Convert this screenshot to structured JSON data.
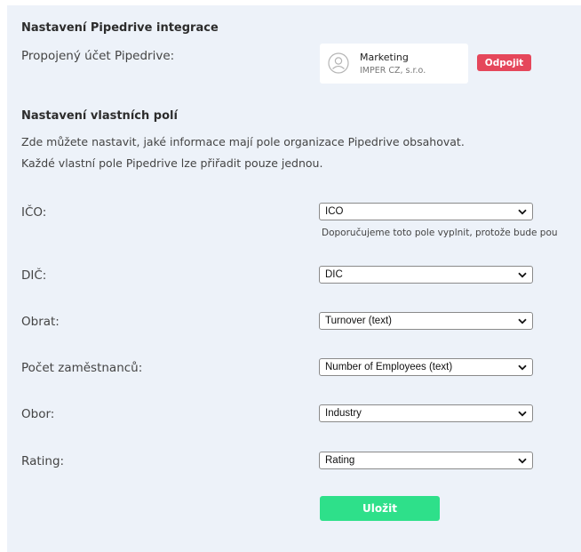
{
  "integration": {
    "heading": "Nastavení Pipedrive integrace",
    "linked_account_label": "Propojený účet Pipedrive:",
    "account": {
      "name": "Marketing",
      "company": "IMPER CZ, s.r.o.",
      "avatar_icon": "user-circle-icon"
    },
    "disconnect_label": "Odpojit"
  },
  "custom_fields": {
    "heading": "Nastavení vlastních polí",
    "description_line1": "Zde můžete nastavit, jaké informace mají pole organizace Pipedrive obsahovat.",
    "description_line2": "Každé vlastní pole Pipedrive lze přiřadit pouze jednou.",
    "rows": [
      {
        "label": "IČO:",
        "selected": "ICO"
      },
      {
        "label": "DIČ:",
        "selected": "DIC"
      },
      {
        "label": "Obrat:",
        "selected": "Turnover (text)"
      },
      {
        "label": "Počet zaměstnanců:",
        "selected": "Number of Employees (text)"
      },
      {
        "label": "Obor:",
        "selected": "Industry"
      },
      {
        "label": "Rating:",
        "selected": "Rating"
      }
    ],
    "ico_hint": "Doporučujeme toto pole vyplnit, protože bude pou"
  },
  "save_label": "Uložit",
  "colors": {
    "panel_bg": "#edf2f9",
    "disconnect": "#e5475b",
    "save": "#2ee08a"
  }
}
